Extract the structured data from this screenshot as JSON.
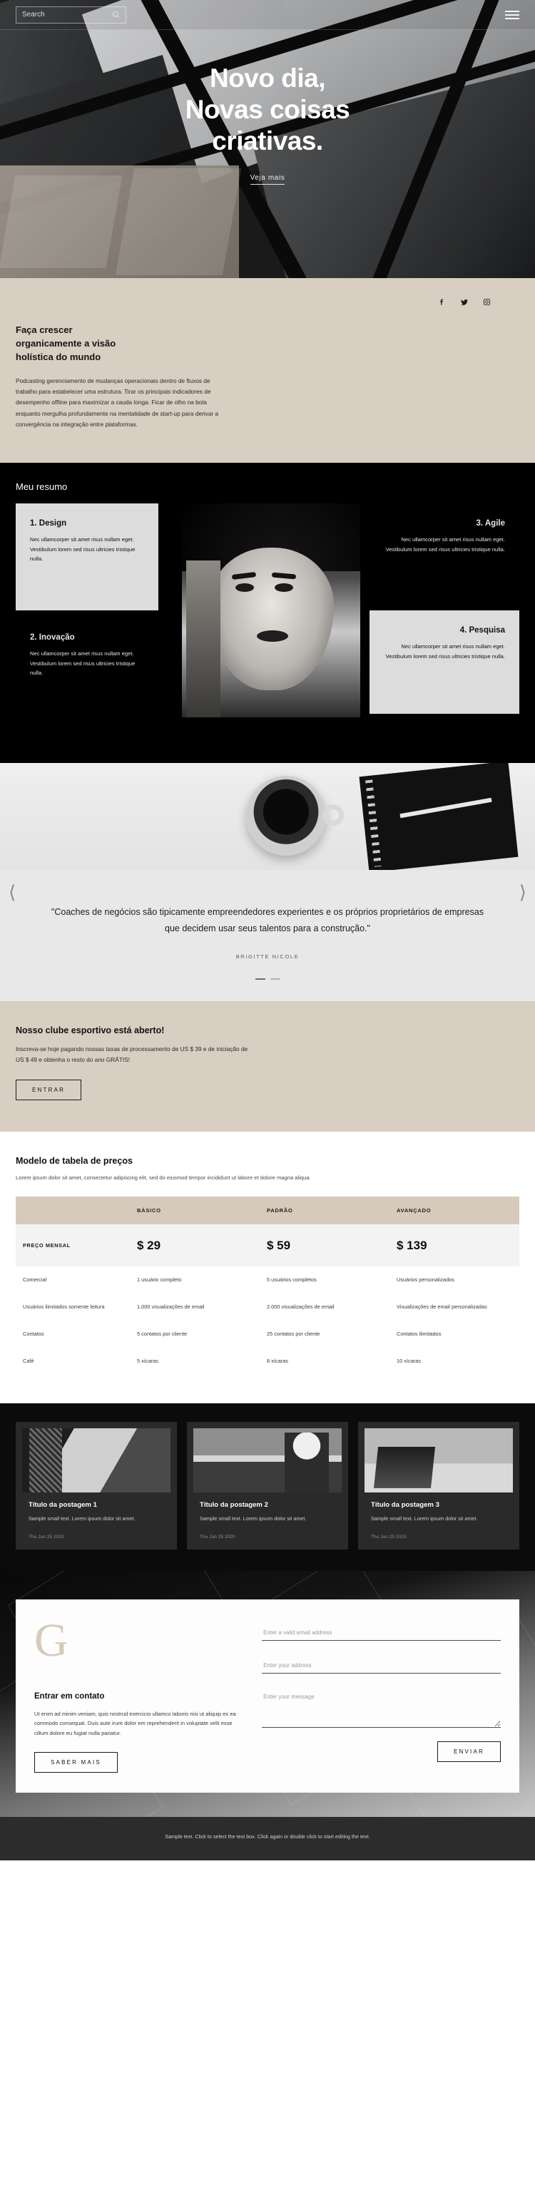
{
  "header": {
    "search_placeholder": "Search",
    "search_value": "",
    "search_icon": "search-icon",
    "menu_icon": "hamburger-menu-icon"
  },
  "hero": {
    "title_line1": "Novo dia,",
    "title_line2": "Novas coisas",
    "title_line3": "criativas.",
    "cta": "Veja mais"
  },
  "organic": {
    "socials": [
      {
        "name": "facebook-icon",
        "glyph": "f"
      },
      {
        "name": "twitter-icon",
        "glyph": "t"
      },
      {
        "name": "instagram-icon",
        "glyph": "i"
      }
    ],
    "heading": "Faça crescer organicamente a visão holística do mundo",
    "body": "Podcasting gerenciamento de mudanças operacionais dentro de fluxos de trabalho para estabelecer uma estrutura. Tirar os principais indicadores de desempenho offline para maximizar a cauda longa. Ficar de olho na bola enquanto mergulha profundamente na mentalidade de start-up para derivar a convergência na integração entre plataformas."
  },
  "resumo": {
    "title": "Meu resumo",
    "body_text": "Nec ullamcorper sit amet risus nullam eget. Vestibulum lorem sed risus ultricies tristique nulla.",
    "cards": [
      {
        "title": "1. Design",
        "text": "Nec ullamcorper sit amet risus nullam eget. Vestibulum lorem sed risus ultricies tristique nulla."
      },
      {
        "title": "2. Inovação",
        "text": "Nec ullamcorper sit amet risus nullam eget. Vestibulum lorem sed risus ultricies tristique nulla."
      },
      {
        "title": "3. Agile",
        "text": "Nec ullamcorper sit amet risus nullam eget. Vestibulum lorem sed risus ultricies tristique nulla."
      },
      {
        "title": "4. Pesquisa",
        "text": "Nec ullamcorper sit amet risus nullam eget. Vestibulum lorem sed risus ultricies tristique nulla."
      }
    ]
  },
  "testimonial": {
    "prev_icon": "chevron-left-icon",
    "next_icon": "chevron-right-icon",
    "quote": "\"Coaches de negócios são tipicamente empreendedores experientes e os próprios proprietários de empresas que decidem usar seus talentos para a construção.\"",
    "author": "BRIGITTE NICOLE"
  },
  "club": {
    "title": "Nosso clube esportivo está aberto!",
    "text": "Inscreva-se hoje pagando nossas taxas de processamento de US $ 39 e de iniciação de US $ 49 e obtenha o resto do ano GRÁTIS!",
    "button": "ENTRAR"
  },
  "pricing": {
    "title": "Modelo de tabela de preços",
    "subtitle": "Lorem ipsum dolor sit amet, consectetur adipiscing elit, sed do eiusmod tempor incididunt ut labore et dolore magna aliqua.",
    "columns": [
      "",
      "BÁSICO",
      "PADRÃO",
      "AVANÇADO"
    ],
    "price_row": {
      "label": "PREÇO MENSAL",
      "values": [
        "$ 29",
        "$ 59",
        "$ 139"
      ]
    },
    "rows": [
      {
        "label": "Comercial",
        "values": [
          "1 usuário completo",
          "5 usuários completos",
          "Usuários personalizados"
        ]
      },
      {
        "label": "Usuários ilimitados somente leitura",
        "values": [
          "1.000 visualizações de email",
          "2.000 visualizações de email",
          "Visualizações de email personalizadas"
        ]
      },
      {
        "label": "Contatos",
        "values": [
          "5 contatos por cliente",
          "25 contatos por cliente",
          "Contatos ilimitados"
        ]
      },
      {
        "label": "Café",
        "values": [
          "5 xícaras",
          "8 xícaras",
          "10 xícaras"
        ]
      }
    ]
  },
  "blog": {
    "posts": [
      {
        "title": "Título da postagem 1",
        "excerpt": "Sample small text. Lorem ipsum dolor sit amet.",
        "date": "Thu Jun 25 2020"
      },
      {
        "title": "Título da postagem 2",
        "excerpt": "Sample small text. Lorem ipsum dolor sit amet.",
        "date": "Thu Jun 25 2020"
      },
      {
        "title": "Título da postagem 3",
        "excerpt": "Sample small text. Lorem ipsum dolor sit amet.",
        "date": "Thu Jun 25 2020"
      }
    ]
  },
  "contact": {
    "monogram": "G",
    "heading": "Entrar em contato",
    "text": "Ut enim ad minim veniam, quis nostrud exercicio ullamco laboris nisi ut aliquip ex ea commodo consequat. Duis aute irure dolor em reprehenderit in voluptate velit esse cillum dolore eu fugiat nulla pariatur.",
    "learn_more": "SABER MAIS",
    "email_placeholder": "Enter a valid email address",
    "email_value": "",
    "address_placeholder": "Enter your address",
    "address_value": "",
    "message_placeholder": "Enter your message",
    "message_value": "",
    "submit": "ENVIAR"
  },
  "footer": {
    "text": "Sample text. Click to select the text box. Click again or double click to start editing the text."
  },
  "colors": {
    "beige": "#d8cec2",
    "dark": "#0b0b0b",
    "card_light": "#dcdcdc",
    "footer_bg": "#2c2c2c"
  }
}
